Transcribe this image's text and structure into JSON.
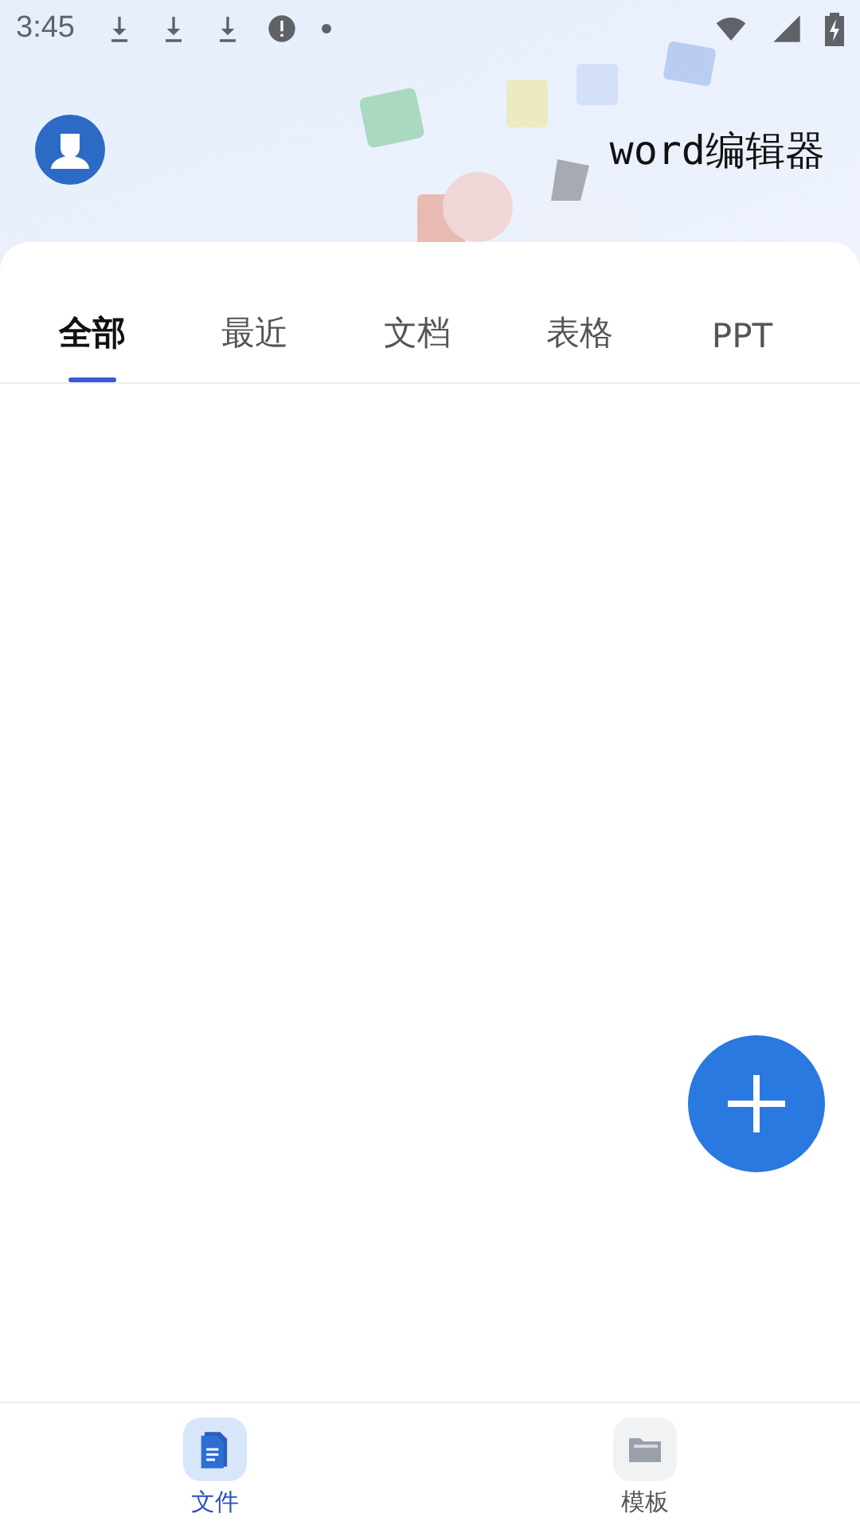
{
  "status_bar": {
    "time": "3:45"
  },
  "header": {
    "title": "word编辑器"
  },
  "tabs": [
    {
      "label": "全部",
      "selected": true
    },
    {
      "label": "最近",
      "selected": false
    },
    {
      "label": "文档",
      "selected": false
    },
    {
      "label": "表格",
      "selected": false
    },
    {
      "label": "PPT",
      "selected": false
    }
  ],
  "bottom_nav": [
    {
      "label": "文件",
      "kind": "files",
      "selected": true
    },
    {
      "label": "模板",
      "kind": "templates",
      "selected": false
    }
  ]
}
